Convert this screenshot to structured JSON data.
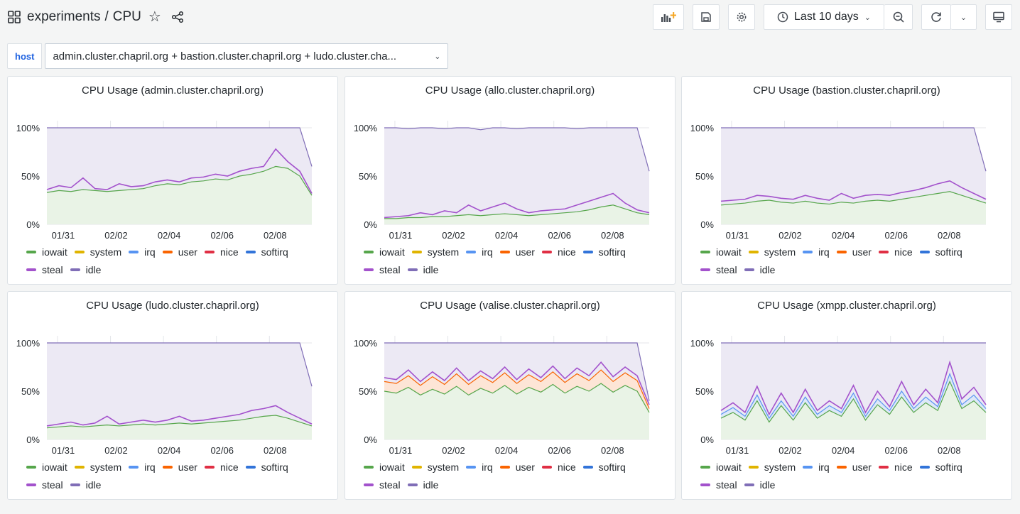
{
  "header": {
    "folder": "experiments",
    "separator": "/",
    "title": "CPU",
    "time_range": "Last 10 days"
  },
  "variable": {
    "label": "host",
    "value": "admin.cluster.chapril.org + bastion.cluster.chapril.org + ludo.cluster.cha..."
  },
  "colors": {
    "iowait": "#56a64b",
    "system": "#e0b400",
    "irq": "#5794f2",
    "user": "#fa6400",
    "nice": "#e02f44",
    "softirq": "#3274d9",
    "steal": "#a352cc",
    "idle": "#806eb7"
  },
  "legend": [
    "iowait",
    "system",
    "irq",
    "user",
    "nice",
    "softirq",
    "steal",
    "idle"
  ],
  "panels": [
    {
      "title": "CPU Usage (admin.cluster.chapril.org)",
      "chart_data": {
        "type": "area",
        "x_ticks": [
          "01/31",
          "02/02",
          "02/04",
          "02/06",
          "02/08"
        ],
        "y_ticks": [
          "0%",
          "50%",
          "100%"
        ],
        "ylim": [
          0,
          100
        ],
        "series": [
          {
            "name": "iowait",
            "values": [
              33,
              35,
              34,
              36,
              35,
              34,
              35,
              36,
              37,
              40,
              42,
              41,
              44,
              45,
              47,
              46,
              50,
              52,
              55,
              60,
              58,
              50,
              30
            ]
          },
          {
            "name": "steal",
            "values": [
              36,
              40,
              38,
              48,
              37,
              36,
              42,
              39,
              40,
              44,
              46,
              44,
              48,
              49,
              52,
              50,
              55,
              58,
              60,
              78,
              65,
              55,
              32
            ]
          },
          {
            "name": "idle",
            "values": [
              100,
              100,
              100,
              100,
              100,
              100,
              100,
              100,
              100,
              100,
              100,
              100,
              100,
              100,
              100,
              100,
              100,
              100,
              100,
              100,
              100,
              100,
              60
            ]
          }
        ]
      }
    },
    {
      "title": "CPU Usage (allo.cluster.chapril.org)",
      "chart_data": {
        "type": "area",
        "x_ticks": [
          "01/31",
          "02/02",
          "02/04",
          "02/06",
          "02/08"
        ],
        "y_ticks": [
          "0%",
          "50%",
          "100%"
        ],
        "ylim": [
          0,
          100
        ],
        "series": [
          {
            "name": "iowait",
            "values": [
              6,
              6,
              7,
              7,
              8,
              8,
              9,
              10,
              9,
              10,
              11,
              10,
              9,
              10,
              11,
              12,
              13,
              15,
              18,
              20,
              16,
              12,
              10
            ]
          },
          {
            "name": "steal",
            "values": [
              7,
              8,
              9,
              12,
              10,
              14,
              12,
              20,
              14,
              18,
              22,
              16,
              12,
              14,
              15,
              16,
              20,
              24,
              28,
              32,
              22,
              15,
              12
            ]
          },
          {
            "name": "idle",
            "values": [
              100,
              100,
              99,
              100,
              100,
              99,
              100,
              100,
              98,
              100,
              100,
              99,
              100,
              100,
              100,
              100,
              99,
              100,
              100,
              100,
              100,
              100,
              55
            ]
          }
        ]
      }
    },
    {
      "title": "CPU Usage (bastion.cluster.chapril.org)",
      "chart_data": {
        "type": "area",
        "x_ticks": [
          "01/31",
          "02/02",
          "02/04",
          "02/06",
          "02/08"
        ],
        "y_ticks": [
          "0%",
          "50%",
          "100%"
        ],
        "ylim": [
          0,
          100
        ],
        "series": [
          {
            "name": "iowait",
            "values": [
              20,
              21,
              22,
              24,
              25,
              23,
              22,
              24,
              22,
              21,
              23,
              22,
              24,
              25,
              24,
              26,
              28,
              30,
              32,
              34,
              30,
              26,
              22
            ]
          },
          {
            "name": "steal",
            "values": [
              24,
              25,
              26,
              30,
              29,
              27,
              26,
              30,
              27,
              25,
              32,
              27,
              30,
              31,
              30,
              33,
              35,
              38,
              42,
              45,
              38,
              32,
              26
            ]
          },
          {
            "name": "idle",
            "values": [
              100,
              100,
              100,
              100,
              100,
              100,
              100,
              100,
              100,
              100,
              100,
              100,
              100,
              100,
              100,
              100,
              100,
              100,
              100,
              100,
              100,
              100,
              55
            ]
          }
        ]
      }
    },
    {
      "title": "CPU Usage (ludo.cluster.chapril.org)",
      "chart_data": {
        "type": "area",
        "x_ticks": [
          "01/31",
          "02/02",
          "02/04",
          "02/06",
          "02/08"
        ],
        "y_ticks": [
          "0%",
          "50%",
          "100%"
        ],
        "ylim": [
          0,
          100
        ],
        "series": [
          {
            "name": "iowait",
            "values": [
              12,
              13,
              14,
              13,
              14,
              15,
              14,
              15,
              16,
              15,
              16,
              17,
              16,
              17,
              18,
              19,
              20,
              22,
              24,
              25,
              22,
              18,
              14
            ]
          },
          {
            "name": "steal",
            "values": [
              14,
              16,
              18,
              15,
              17,
              24,
              16,
              18,
              20,
              18,
              20,
              24,
              19,
              20,
              22,
              24,
              26,
              30,
              32,
              35,
              28,
              22,
              16
            ]
          },
          {
            "name": "idle",
            "values": [
              100,
              100,
              100,
              100,
              100,
              100,
              100,
              100,
              100,
              100,
              100,
              100,
              100,
              100,
              100,
              100,
              100,
              100,
              100,
              100,
              100,
              100,
              55
            ]
          }
        ]
      }
    },
    {
      "title": "CPU Usage (valise.cluster.chapril.org)",
      "chart_data": {
        "type": "area",
        "x_ticks": [
          "01/31",
          "02/02",
          "02/04",
          "02/06",
          "02/08"
        ],
        "y_ticks": [
          "0%",
          "50%",
          "100%"
        ],
        "ylim": [
          0,
          100
        ],
        "series": [
          {
            "name": "iowait",
            "values": [
              50,
              48,
              54,
              46,
              52,
              47,
              55,
              46,
              53,
              48,
              56,
              47,
              54,
              49,
              57,
              48,
              55,
              50,
              58,
              49,
              56,
              50,
              28
            ]
          },
          {
            "name": "user",
            "values": [
              60,
              58,
              66,
              56,
              65,
              57,
              68,
              57,
              66,
              59,
              69,
              58,
              67,
              60,
              70,
              59,
              68,
              61,
              72,
              60,
              69,
              61,
              32
            ]
          },
          {
            "name": "steal",
            "values": [
              64,
              62,
              72,
              60,
              70,
              61,
              74,
              61,
              71,
              63,
              75,
              62,
              73,
              64,
              76,
              63,
              74,
              66,
              80,
              65,
              75,
              66,
              36
            ]
          },
          {
            "name": "idle",
            "values": [
              100,
              100,
              100,
              100,
              100,
              100,
              100,
              100,
              100,
              100,
              100,
              100,
              100,
              100,
              100,
              100,
              100,
              100,
              100,
              100,
              100,
              100,
              40
            ]
          }
        ]
      }
    },
    {
      "title": "CPU Usage (xmpp.cluster.chapril.org)",
      "chart_data": {
        "type": "area",
        "x_ticks": [
          "01/31",
          "02/02",
          "02/04",
          "02/06",
          "02/08"
        ],
        "y_ticks": [
          "0%",
          "50%",
          "100%"
        ],
        "ylim": [
          0,
          100
        ],
        "series": [
          {
            "name": "iowait",
            "values": [
              22,
              28,
              20,
              40,
              18,
              35,
              20,
              38,
              22,
              30,
              24,
              42,
              20,
              36,
              26,
              44,
              28,
              38,
              30,
              60,
              32,
              40,
              28
            ]
          },
          {
            "name": "irq",
            "values": [
              26,
              33,
              24,
              46,
              22,
              40,
              24,
              44,
              26,
              35,
              28,
              48,
              24,
              42,
              30,
              50,
              32,
              44,
              34,
              68,
              36,
              46,
              32
            ]
          },
          {
            "name": "steal",
            "values": [
              30,
              38,
              28,
              55,
              26,
              48,
              28,
              52,
              30,
              40,
              32,
              56,
              28,
              50,
              34,
              60,
              36,
              52,
              38,
              80,
              42,
              54,
              36
            ]
          },
          {
            "name": "idle",
            "values": [
              100,
              100,
              100,
              100,
              100,
              100,
              100,
              100,
              100,
              100,
              100,
              100,
              100,
              100,
              100,
              100,
              100,
              100,
              100,
              100,
              100,
              100,
              100
            ]
          }
        ]
      }
    }
  ]
}
